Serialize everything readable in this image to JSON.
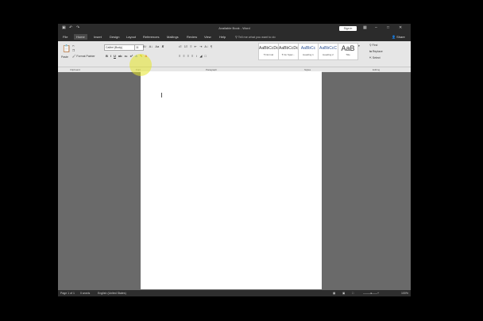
{
  "window": {
    "title": "Available Book - Word",
    "sign_in_label": "Sign in",
    "share_label": "Share"
  },
  "tabs": [
    "File",
    "Home",
    "Insert",
    "Design",
    "Layout",
    "References",
    "Mailings",
    "Review",
    "View",
    "Help"
  ],
  "tell_me_placeholder": "Tell me what you want to do",
  "clipboard": {
    "paste_label": "Paste",
    "format_painter_label": "Format Painter"
  },
  "font": {
    "name": "Calibri (Body)",
    "size": "11"
  },
  "styles": [
    {
      "preview": "AaBbCcDc",
      "name": "¶ Normal"
    },
    {
      "preview": "AaBbCcDc",
      "name": "¶ No Spac..."
    },
    {
      "preview": "AaBbCc",
      "name": "Heading 1"
    },
    {
      "preview": "AaBbCcC",
      "name": "Heading 2"
    },
    {
      "preview": "AaB",
      "name": "Title"
    }
  ],
  "editing": {
    "find": "Find",
    "replace": "Replace",
    "select": "Select"
  },
  "group_labels": {
    "clipboard": "Clipboard",
    "font": "Font",
    "paragraph": "Paragraph",
    "styles": "Styles",
    "editing": "Editing"
  },
  "status": {
    "page": "Page 1 of 1",
    "words": "0 words",
    "language": "English (United States)",
    "zoom": "100%"
  }
}
